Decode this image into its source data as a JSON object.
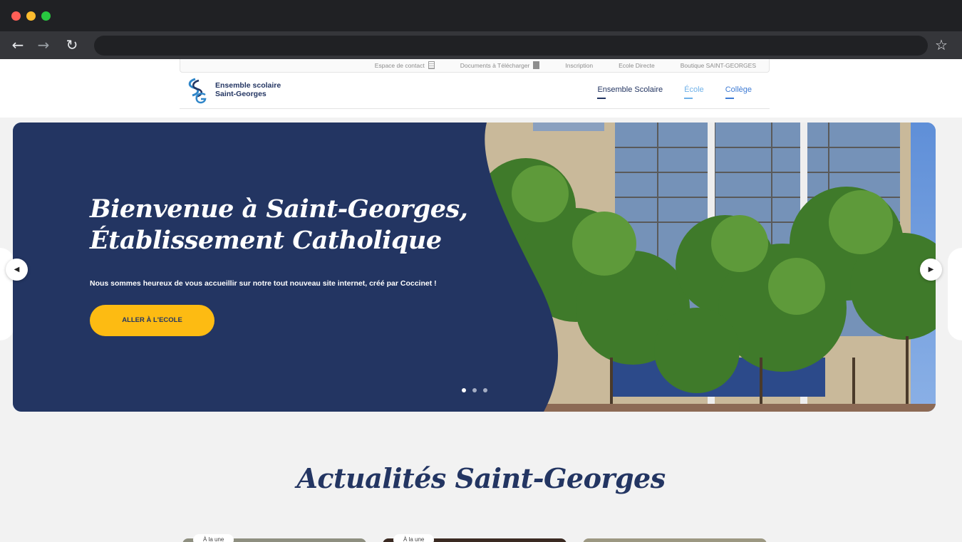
{
  "topbar": {
    "links": [
      {
        "label": "Espace de contact",
        "icon": "building-icon"
      },
      {
        "label": "Documents à Télécharger",
        "icon": "download-icon"
      },
      {
        "label": "Inscription"
      },
      {
        "label": "Ecole Directe"
      },
      {
        "label": "Boutique SAINT-GEORGES"
      }
    ]
  },
  "brand": {
    "line1": "Ensemble scolaire",
    "line2": "Saint-Georges"
  },
  "mainnav": {
    "items": [
      {
        "label": "Ensemble Scolaire",
        "color": "#233562"
      },
      {
        "label": "École",
        "color": "#6fb1e8"
      },
      {
        "label": "Collège",
        "color": "#3e7bd4"
      }
    ]
  },
  "hero": {
    "title_line1": "Bienvenue à Saint-Georges,",
    "title_line2": "Établissement Catholique",
    "subtitle": "Nous sommes heureux de vous accueillir sur notre tout nouveau site internet, créé par Coccinet !",
    "button_label": "ALLER À L'ECOLE",
    "slide_count": 3,
    "active_slide": 1
  },
  "news": {
    "title": "Actualités Saint-Georges",
    "badge": "À la une"
  },
  "colors": {
    "navy": "#233562",
    "accent_yellow": "#fdbb12",
    "ecole_blue": "#6fb1e8",
    "college_blue": "#3e7bd4"
  }
}
